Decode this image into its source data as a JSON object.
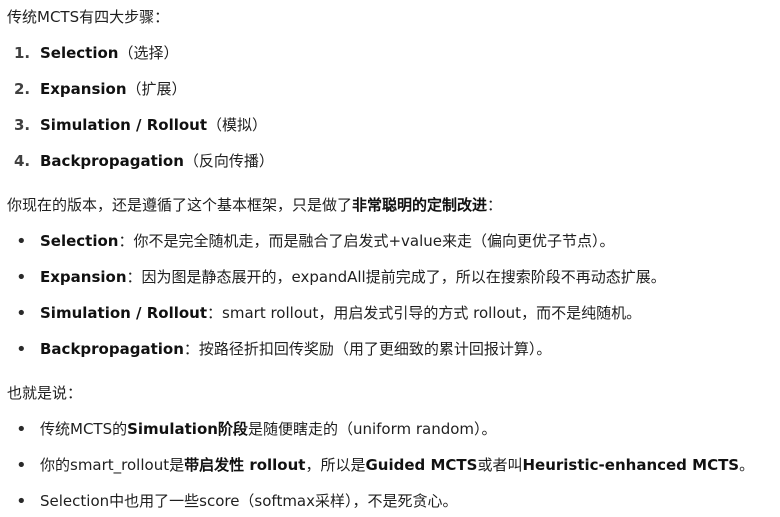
{
  "intro": "传统MCTS有四大步骤：",
  "steps": [
    {
      "num": "1.",
      "bold": "Selection",
      "rest": "（选择）"
    },
    {
      "num": "2.",
      "bold": "Expansion",
      "rest": "（扩展）"
    },
    {
      "num": "3.",
      "bold": "Simulation / Rollout",
      "rest": "（模拟）"
    },
    {
      "num": "4.",
      "bold": "Backpropagation",
      "rest": "（反向传播）"
    }
  ],
  "current": {
    "pre": "你现在的版本，还是遵循了这个基本框架，只是做了",
    "bold": "非常聪明的定制改进",
    "post": "："
  },
  "improvements": [
    {
      "bold": "Selection",
      "rest": "：你不是完全随机走，而是融合了启发式+value来走（偏向更优子节点）。"
    },
    {
      "bold": "Expansion",
      "rest": "：因为图是静态展开的，expandAll提前完成了，所以在搜索阶段不再动态扩展。"
    },
    {
      "bold": "Simulation / Rollout",
      "rest": "：smart rollout，用启发式引导的方式 rollout，而不是纯随机。"
    },
    {
      "bold": "Backpropagation",
      "rest": "：按路径折扣回传奖励（用了更细致的累计回报计算）。"
    }
  ],
  "summary_intro": "也就是说：",
  "summary": [
    {
      "p1": "传统MCTS的",
      "b1": "Simulation阶段",
      "p2": "是随便瞎走的（uniform random）。",
      "b2": "",
      "p3": "",
      "b3": "",
      "p4": ""
    },
    {
      "p1": "你的smart_rollout是",
      "b1": "带启发性 rollout",
      "p2": "，所以是",
      "b2": "Guided MCTS",
      "p3": "或者叫",
      "b3": "Heuristic-enhanced MCTS",
      "p4": "。"
    },
    {
      "p1": "Selection中也用了一些score（softmax采样），不是死贪心。",
      "b1": "",
      "p2": "",
      "b2": "",
      "p3": "",
      "b3": "",
      "p4": ""
    }
  ]
}
